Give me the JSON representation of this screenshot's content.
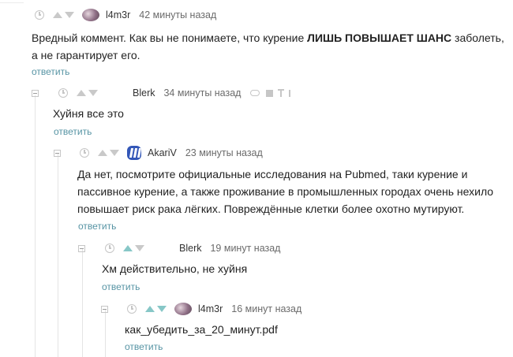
{
  "comments": [
    {
      "author": "l4m3r",
      "time": "42 минуты назад",
      "body_parts": [
        "Вредный коммент. Как вы не понимаете, что курение ",
        "ЛИШЬ ПОВЫШАЕТ ШАНС",
        " заболеть, а не гарантирует его."
      ],
      "reply": "ответить"
    },
    {
      "author": "Blerk",
      "time": "34 минуты назад",
      "body": "Хуйня все это",
      "reply": "ответить"
    },
    {
      "author": "AkariV",
      "time": "23 минуты назад",
      "body": "Да нет, посмотрите официальные исследования на Pubmed, таки курение и пассивное курение, а также проживание в промышленных городах очень нехило повышает риск рака лёгких. Повреждённые клетки более охотно мутируют.",
      "reply": "ответить"
    },
    {
      "author": "Blerk",
      "time": "19 минут назад",
      "body": "Хм действительно, не хуйня",
      "reply": "ответить"
    },
    {
      "author": "l4m3r",
      "time": "16 минут назад",
      "body": "как_убедить_за_20_минут.pdf",
      "reply": "ответить"
    }
  ],
  "colors": {
    "link": "#5794a4",
    "vote_active": "#87c7c7",
    "icon_gray": "#c6c6c6"
  },
  "icons": [
    "clock-icon",
    "upvote-icon",
    "downvote-icon",
    "avatar",
    "collapse-icon",
    "link-icon",
    "save-icon",
    "pin-icon",
    "hand-icon"
  ]
}
